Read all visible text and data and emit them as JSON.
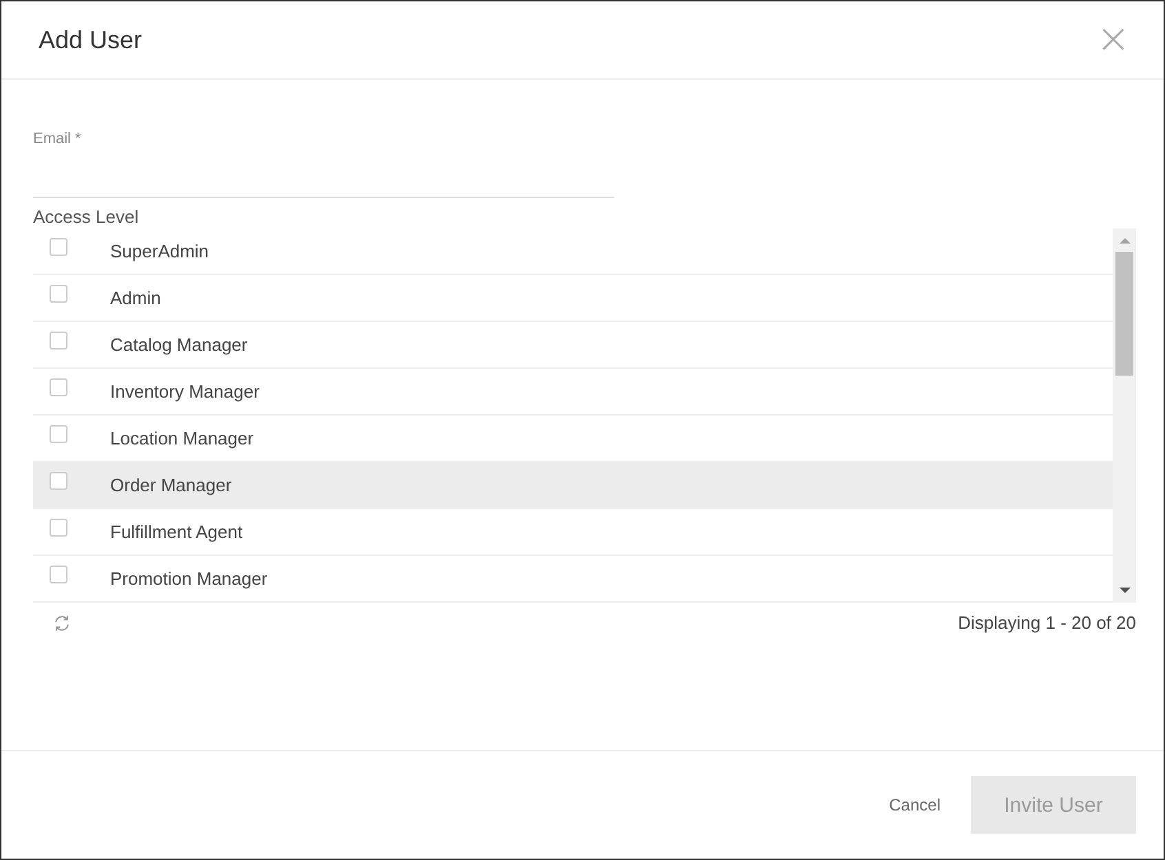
{
  "dialog": {
    "title": "Add User",
    "close": "×"
  },
  "email": {
    "label": "Email *"
  },
  "access_level": {
    "label": "Access Level",
    "items": [
      {
        "label": "SuperAdmin",
        "checked": false,
        "hovered": false
      },
      {
        "label": "Admin",
        "checked": false,
        "hovered": false
      },
      {
        "label": "Catalog Manager",
        "checked": false,
        "hovered": false
      },
      {
        "label": "Inventory Manager",
        "checked": false,
        "hovered": false
      },
      {
        "label": "Location Manager",
        "checked": false,
        "hovered": false
      },
      {
        "label": "Order Manager",
        "checked": false,
        "hovered": true
      },
      {
        "label": "Fulfillment Agent",
        "checked": false,
        "hovered": false
      },
      {
        "label": "Promotion Manager",
        "checked": false,
        "hovered": false
      }
    ],
    "paging": "Displaying 1 - 20 of 20"
  },
  "buttons": [
    {
      "label": "Cancel",
      "kind": "link",
      "disabled": false
    },
    {
      "label": "Invite User",
      "kind": "primary",
      "disabled": true
    }
  ]
}
